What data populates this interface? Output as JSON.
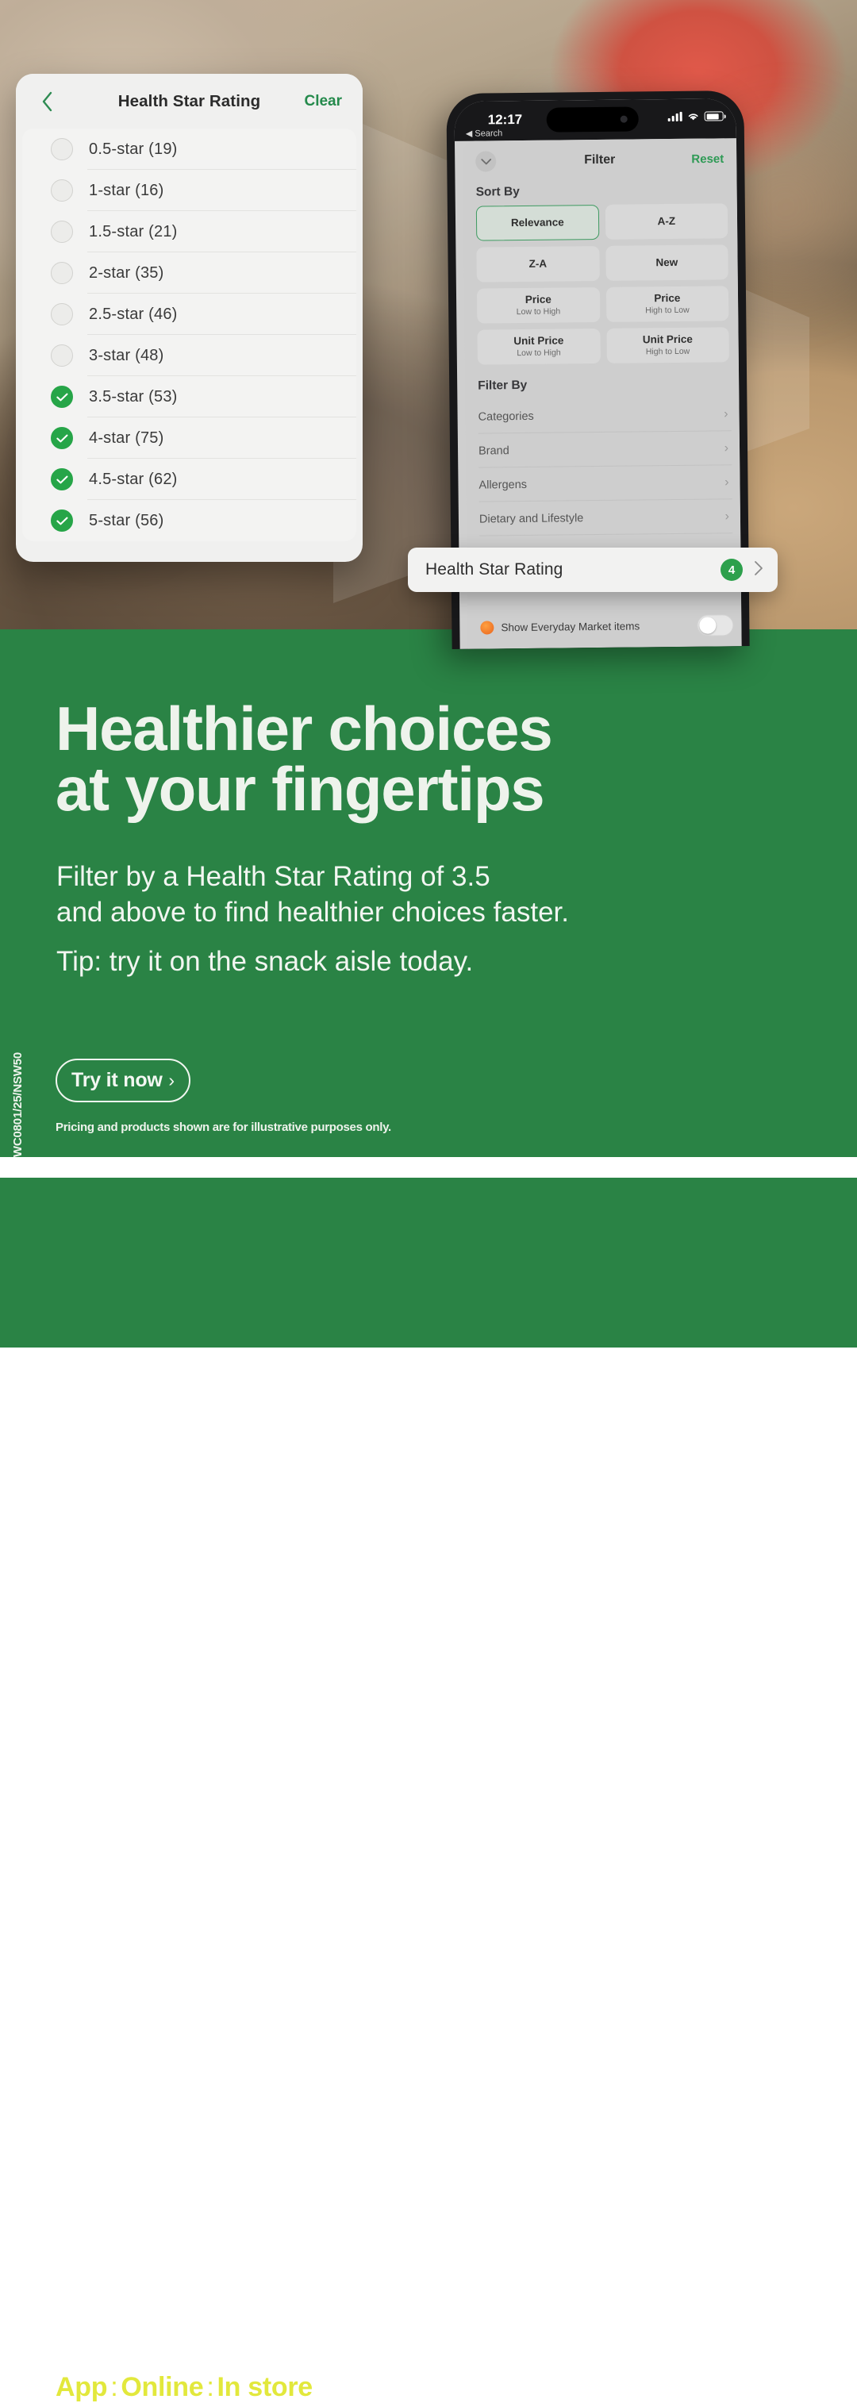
{
  "hsr_panel": {
    "title": "Health Star Rating",
    "back_icon": "chevron-left-icon",
    "clear_label": "Clear",
    "options": [
      {
        "label": "0.5-star (19)",
        "checked": false
      },
      {
        "label": "1-star (16)",
        "checked": false
      },
      {
        "label": "1.5-star (21)",
        "checked": false
      },
      {
        "label": "2-star (35)",
        "checked": false
      },
      {
        "label": "2.5-star (46)",
        "checked": false
      },
      {
        "label": "3-star (48)",
        "checked": false
      },
      {
        "label": "3.5-star (53)",
        "checked": true
      },
      {
        "label": "4-star (75)",
        "checked": true
      },
      {
        "label": "4.5-star (62)",
        "checked": true
      },
      {
        "label": "5-star (56)",
        "checked": true
      }
    ]
  },
  "phone": {
    "status": {
      "time": "12:17",
      "back_app": "◀ Search",
      "signal_icon": "cellular-bars-icon",
      "wifi_icon": "wifi-icon",
      "battery_icon": "battery-icon"
    },
    "sheet": {
      "collapse_icon": "chevron-down-icon",
      "title": "Filter",
      "reset_label": "Reset",
      "sort_section_label": "Sort By",
      "sort_options": [
        {
          "t1": "Relevance",
          "t2": "",
          "selected": true
        },
        {
          "t1": "A-Z",
          "t2": "",
          "selected": false
        },
        {
          "t1": "Z-A",
          "t2": "",
          "selected": false
        },
        {
          "t1": "New",
          "t2": "",
          "selected": false
        },
        {
          "t1": "Price",
          "t2": "Low to High",
          "selected": false
        },
        {
          "t1": "Price",
          "t2": "High to Low",
          "selected": false
        },
        {
          "t1": "Unit Price",
          "t2": "Low to High",
          "selected": false
        },
        {
          "t1": "Unit Price",
          "t2": "High to Low",
          "selected": false
        }
      ],
      "filter_section_label": "Filter By",
      "filter_rows": [
        {
          "label": "Categories",
          "chevron": "›"
        },
        {
          "label": "Brand",
          "chevron": "›"
        },
        {
          "label": "Allergens",
          "chevron": "›"
        },
        {
          "label": "Dietary and Lifestyle",
          "chevron": "›"
        }
      ],
      "toggle_row": {
        "icon": "everyday-market-icon",
        "label": "Show Everyday Market items",
        "state": "off"
      }
    }
  },
  "callout": {
    "label": "Health Star Rating",
    "badge_count": "4",
    "chevron": "›"
  },
  "promo": {
    "headline_line1": "Healthier choices",
    "headline_line2": "at your fingertips",
    "body_line1": "Filter by a Health Star Rating of 3.5",
    "body_line2": "and above to find healthier choices faster.",
    "body_line3": "Tip: try it on the snack aisle today.",
    "cta_label": "Try it now",
    "cta_chevron": "›",
    "disclaimer": "Pricing and products shown are for illustrative purposes only.",
    "vertical_code": "WC0801/25/NSW50"
  },
  "footer": {
    "channels": [
      "App",
      "Online",
      "In store"
    ],
    "separator": ":"
  },
  "colors": {
    "brand_green": "#2a8345",
    "accent_yellow": "#e2e83c",
    "check_green": "#26a548",
    "link_green": "#258a4c"
  }
}
